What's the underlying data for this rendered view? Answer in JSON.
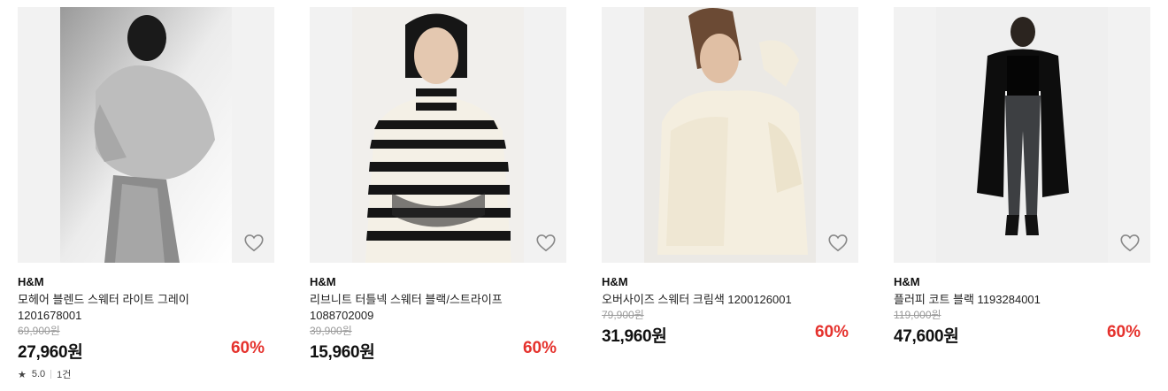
{
  "products": [
    {
      "brand": "H&M",
      "name": "모헤어 블렌드 스웨터 라이트 그레이",
      "code": "1201678001",
      "original_price": "69,900원",
      "price": "27,960원",
      "discount": "60%",
      "rating": "5.0",
      "reviews": "1건",
      "star_icon": "★"
    },
    {
      "brand": "H&M",
      "name": "리브니트 터틀넥 스웨터 블랙/스트라이프",
      "code": "1088702009",
      "original_price": "39,900원",
      "price": "15,960원",
      "discount": "60%"
    },
    {
      "brand": "H&M",
      "name": "오버사이즈 스웨터 크림색 1200126001",
      "original_price": "79,900원",
      "price": "31,960원",
      "discount": "60%"
    },
    {
      "brand": "H&M",
      "name": "플러피 코트 블랙 1193284001",
      "original_price": "119,000원",
      "price": "47,600원",
      "discount": "60%"
    }
  ],
  "colors": {
    "discount": "#e5322d",
    "strike_price": "#9a9a9a"
  }
}
